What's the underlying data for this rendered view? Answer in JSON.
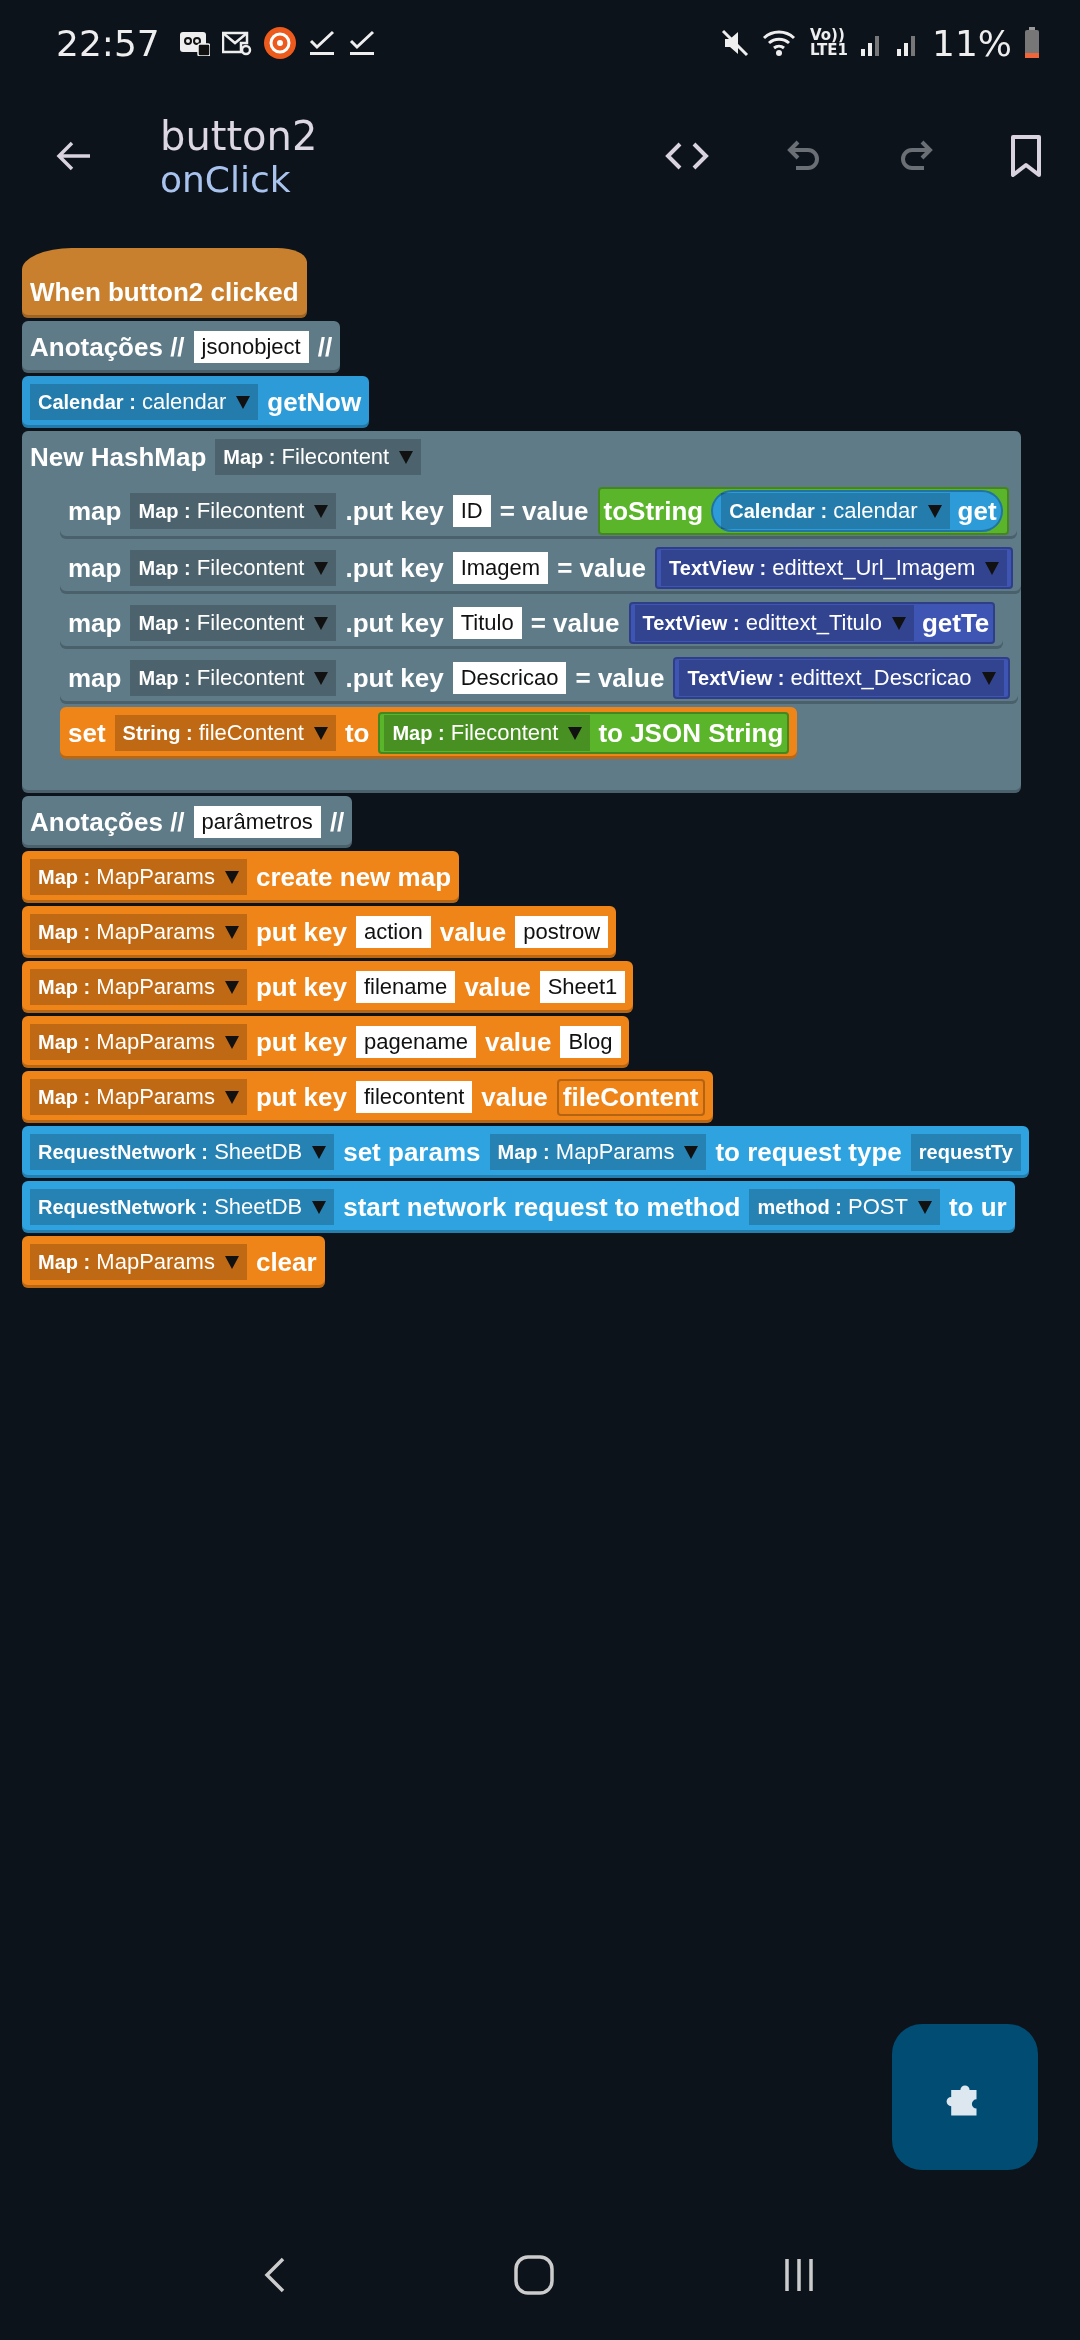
{
  "status_bar": {
    "time": "22:57",
    "volte": "Vo))",
    "network": "LTE1",
    "battery": "11%"
  },
  "header": {
    "title": "button2",
    "subtitle": "onClick",
    "actions": [
      {
        "kind": "code",
        "disabled": false
      },
      {
        "kind": "undo",
        "disabled": true
      },
      {
        "kind": "redo",
        "disabled": true
      },
      {
        "kind": "bookmark",
        "disabled": false
      }
    ]
  },
  "blocks": [
    {
      "kind": "hat",
      "color": "#c8802f",
      "parts": [
        {
          "kind": "label",
          "text": "When button2 clicked"
        }
      ]
    },
    {
      "kind": "stack",
      "color": "#5f7b88",
      "parts": [
        {
          "kind": "label",
          "text": "Anotações //"
        },
        {
          "kind": "field",
          "text": "jsonobject"
        },
        {
          "kind": "label",
          "text": "//"
        }
      ]
    },
    {
      "kind": "stack",
      "color": "#2d9bd7",
      "parts": [
        {
          "kind": "dropdown",
          "text": "**Calendar :** calendar"
        },
        {
          "kind": "label",
          "text": "getNow"
        }
      ]
    },
    {
      "kind": "container",
      "color": "#5f7b88",
      "parts": [
        {
          "kind": "label",
          "text": "New HashMap"
        },
        {
          "kind": "dropdown",
          "text": "**Map :** Filecontent"
        }
      ],
      "children": [
        {
          "kind": "stack",
          "color": "#5f7b88",
          "parts": [
            {
              "kind": "label",
              "text": "map"
            },
            {
              "kind": "dropdown",
              "text": "**Map :** Filecontent"
            },
            {
              "kind": "label",
              "text": ".put key"
            },
            {
              "kind": "field",
              "text": "ID"
            },
            {
              "kind": "label",
              "text": "= value"
            },
            {
              "kind": "reporter",
              "color": "#5bb52a",
              "parts": [
                {
                  "kind": "label",
                  "text": "toString"
                },
                {
                  "kind": "reporter",
                  "color": "#2d9bd7",
                  "parts": [
                    {
                      "kind": "dropdown",
                      "text": "**Calendar :** calendar"
                    },
                    {
                      "kind": "label",
                      "text": "get"
                    }
                  ]
                }
              ]
            }
          ]
        },
        {
          "kind": "stack",
          "color": "#5f7b88",
          "parts": [
            {
              "kind": "label",
              "text": "map"
            },
            {
              "kind": "dropdown",
              "text": "**Map :** Filecontent"
            },
            {
              "kind": "label",
              "text": ".put key"
            },
            {
              "kind": "field",
              "text": "Imagem"
            },
            {
              "kind": "label",
              "text": "= value"
            },
            {
              "kind": "reporter",
              "color": "#3f55b4",
              "parts": [
                {
                  "kind": "dropdown",
                  "text": "**TextView :** edittext_Url_Imagem"
                }
              ]
            }
          ]
        },
        {
          "kind": "stack",
          "color": "#5f7b88",
          "parts": [
            {
              "kind": "label",
              "text": "map"
            },
            {
              "kind": "dropdown",
              "text": "**Map :** Filecontent"
            },
            {
              "kind": "label",
              "text": ".put key"
            },
            {
              "kind": "field",
              "text": "Titulo"
            },
            {
              "kind": "label",
              "text": "= value"
            },
            {
              "kind": "reporter",
              "color": "#3f55b4",
              "parts": [
                {
                  "kind": "dropdown",
                  "text": "**TextView :** edittext_Titulo"
                },
                {
                  "kind": "label",
                  "text": "getTe"
                }
              ]
            }
          ]
        },
        {
          "kind": "stack",
          "color": "#5f7b88",
          "parts": [
            {
              "kind": "label",
              "text": "map"
            },
            {
              "kind": "dropdown",
              "text": "**Map :** Filecontent"
            },
            {
              "kind": "label",
              "text": ".put key"
            },
            {
              "kind": "field",
              "text": "Descricao"
            },
            {
              "kind": "label",
              "text": "= value"
            },
            {
              "kind": "reporter",
              "color": "#3f55b4",
              "parts": [
                {
                  "kind": "dropdown",
                  "text": "**TextView :** edittext_Descricao"
                }
              ]
            }
          ]
        },
        {
          "kind": "stack",
          "color": "#ef8419",
          "parts": [
            {
              "kind": "label",
              "text": "set"
            },
            {
              "kind": "dropdown",
              "text": "**String :** fileContent"
            },
            {
              "kind": "label",
              "text": "to"
            },
            {
              "kind": "reporter",
              "color": "#5bb52a",
              "parts": [
                {
                  "kind": "dropdown",
                  "text": "**Map :** Filecontent"
                },
                {
                  "kind": "label",
                  "text": "to JSON String"
                }
              ]
            }
          ]
        }
      ]
    },
    {
      "kind": "stack",
      "color": "#5f7b88",
      "parts": [
        {
          "kind": "label",
          "text": "Anotações //"
        },
        {
          "kind": "field",
          "text": "parâmetros"
        },
        {
          "kind": "label",
          "text": "//"
        }
      ]
    },
    {
      "kind": "stack",
      "color": "#ef8419",
      "parts": [
        {
          "kind": "dropdown",
          "text": "**Map :** MapParams"
        },
        {
          "kind": "label",
          "text": "create new map"
        }
      ]
    },
    {
      "kind": "stack",
      "color": "#ef8419",
      "parts": [
        {
          "kind": "dropdown",
          "text": "**Map :** MapParams"
        },
        {
          "kind": "label",
          "text": "put key"
        },
        {
          "kind": "field",
          "text": "action"
        },
        {
          "kind": "label",
          "text": "value"
        },
        {
          "kind": "field",
          "text": "postrow"
        }
      ]
    },
    {
      "kind": "stack",
      "color": "#ef8419",
      "parts": [
        {
          "kind": "dropdown",
          "text": "**Map :** MapParams"
        },
        {
          "kind": "label",
          "text": "put key"
        },
        {
          "kind": "field",
          "text": "filename"
        },
        {
          "kind": "label",
          "text": "value"
        },
        {
          "kind": "field",
          "text": "Sheet1"
        }
      ]
    },
    {
      "kind": "stack",
      "color": "#ef8419",
      "parts": [
        {
          "kind": "dropdown",
          "text": "**Map :** MapParams"
        },
        {
          "kind": "label",
          "text": "put key"
        },
        {
          "kind": "field",
          "text": "pagename"
        },
        {
          "kind": "label",
          "text": "value"
        },
        {
          "kind": "field",
          "text": "Blog"
        }
      ]
    },
    {
      "kind": "stack",
      "color": "#ef8419",
      "parts": [
        {
          "kind": "dropdown",
          "text": "**Map :** MapParams"
        },
        {
          "kind": "label",
          "text": "put key"
        },
        {
          "kind": "field",
          "text": "filecontent"
        },
        {
          "kind": "label",
          "text": "value"
        },
        {
          "kind": "reporter",
          "color": "#ef8419",
          "parts": [
            {
              "kind": "label",
              "text": "fileContent"
            }
          ]
        }
      ]
    },
    {
      "kind": "stack",
      "color": "#2fa3e0",
      "parts": [
        {
          "kind": "dropdown",
          "text": "**RequestNetwork :** SheetDB"
        },
        {
          "kind": "label",
          "text": "set params"
        },
        {
          "kind": "dropdown",
          "text": "**Map :** MapParams"
        },
        {
          "kind": "label",
          "text": "to request type"
        },
        {
          "kind": "chip",
          "text": "requestTy"
        }
      ]
    },
    {
      "kind": "stack",
      "color": "#2fa3e0",
      "parts": [
        {
          "kind": "dropdown",
          "text": "**RequestNetwork :** SheetDB"
        },
        {
          "kind": "label",
          "text": "start network request to method"
        },
        {
          "kind": "dropdown",
          "text": "**method :** POST"
        },
        {
          "kind": "label",
          "text": "to ur"
        }
      ]
    },
    {
      "kind": "stack",
      "color": "#ef8419",
      "parts": [
        {
          "kind": "dropdown",
          "text": "**Map :** MapParams"
        },
        {
          "kind": "label",
          "text": "clear"
        }
      ]
    }
  ]
}
